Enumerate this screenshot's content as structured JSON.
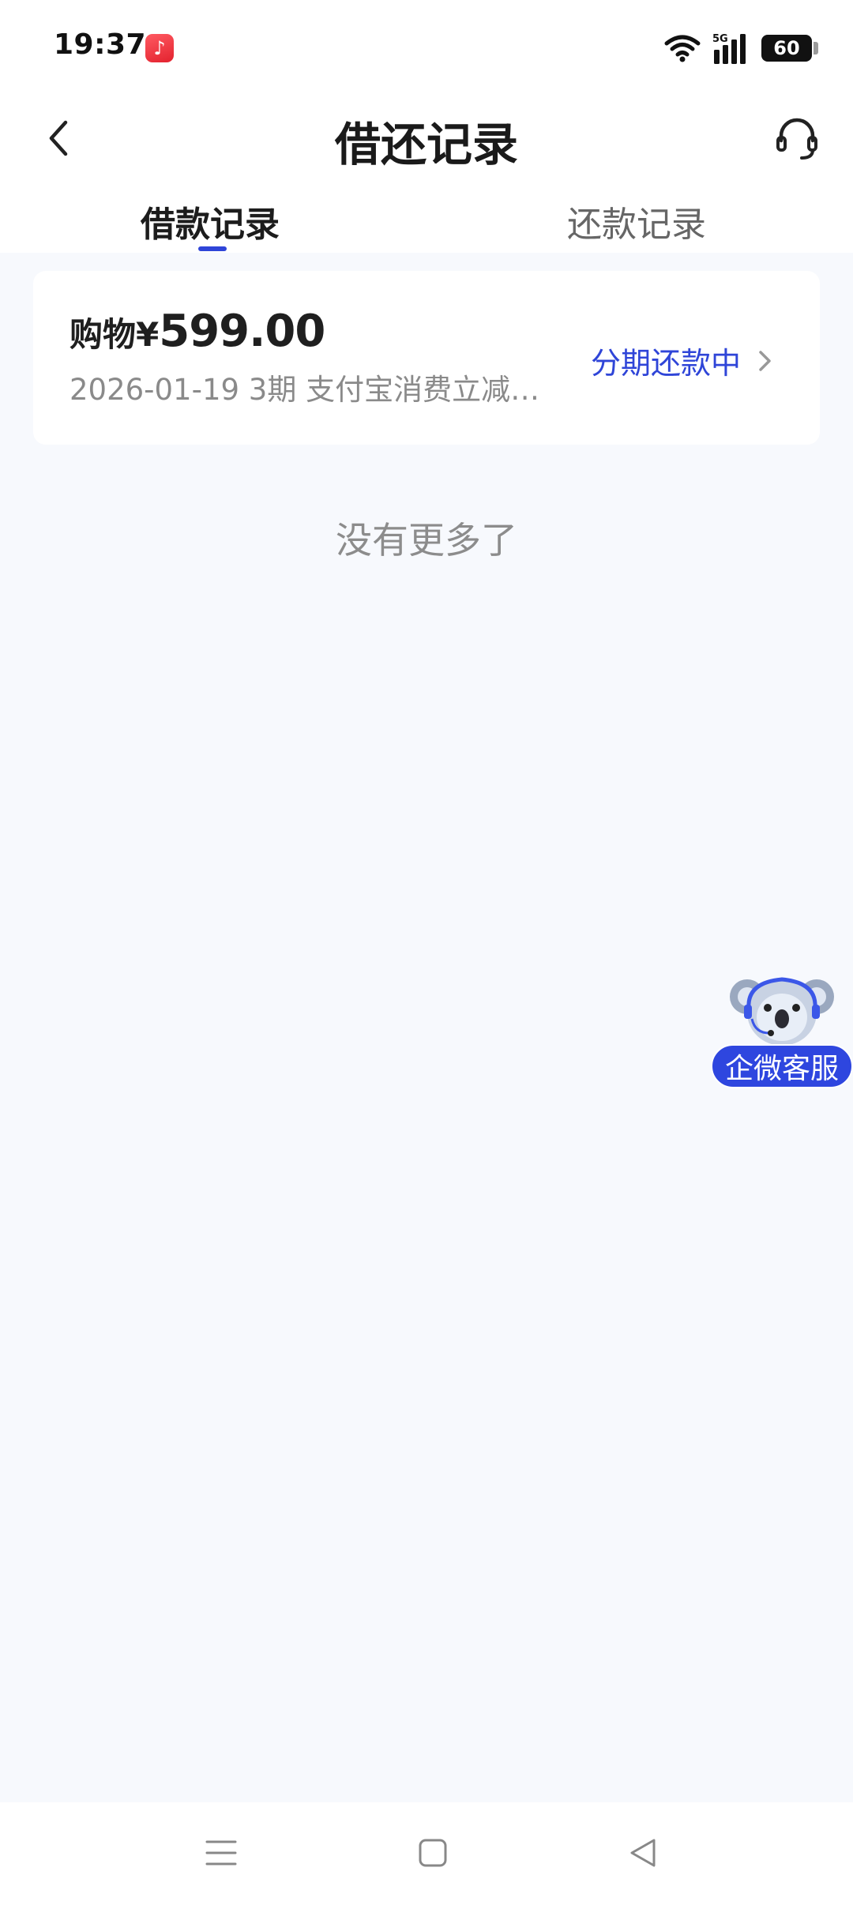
{
  "status_bar": {
    "time": "19:37",
    "battery": "60",
    "network": "5G",
    "icons": [
      "music-app-icon",
      "wifi-icon",
      "signal-icon",
      "battery-icon"
    ]
  },
  "header": {
    "title": "借还记录",
    "back_icon": "chevron-left-icon",
    "service_icon": "headset-icon"
  },
  "tabs": [
    {
      "label": "借款记录",
      "active": true
    },
    {
      "label": "还款记录",
      "active": false
    }
  ],
  "records": [
    {
      "category": "购物",
      "currency": "¥",
      "amount": "599.00",
      "subtitle": "2026-01-19 3期  支付宝消费立减…",
      "status": "分期还款中"
    }
  ],
  "footer_note": "没有更多了",
  "floating_service": {
    "label": "企微客服"
  },
  "colors": {
    "accent": "#2f45d8",
    "background": "#f7f9fd",
    "card": "#ffffff",
    "muted_text": "#8a8a8a"
  }
}
